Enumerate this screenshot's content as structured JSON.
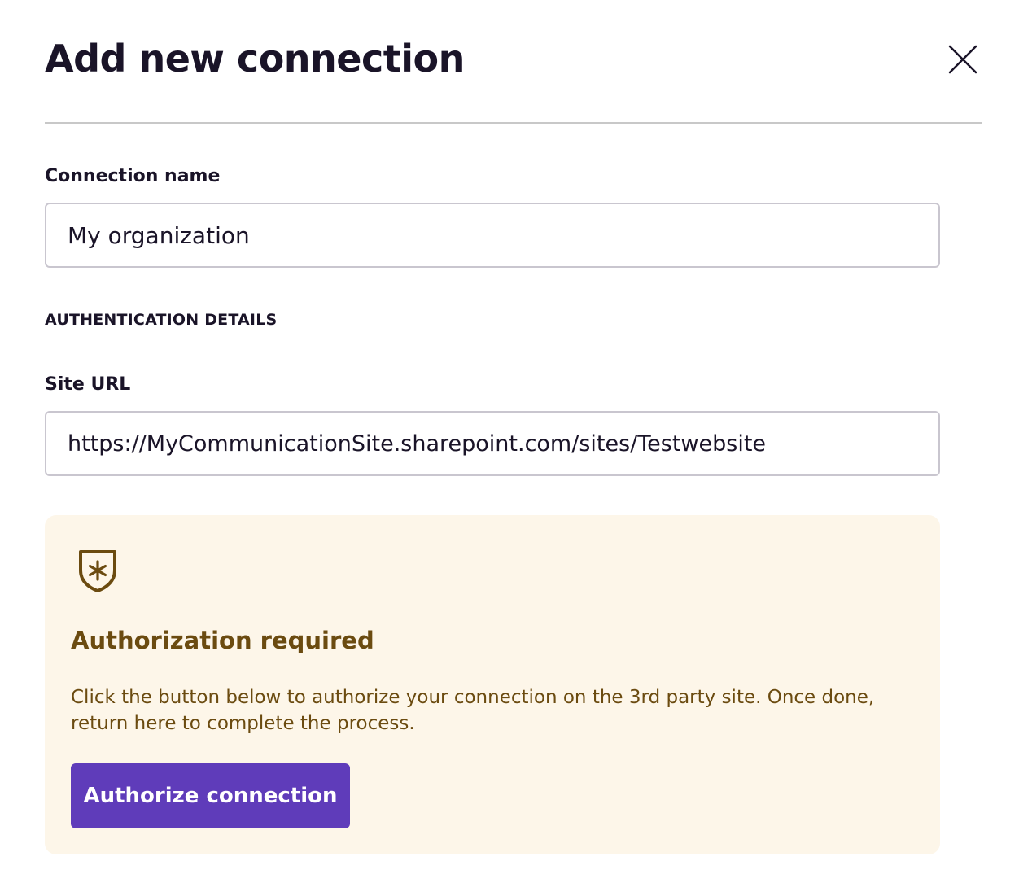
{
  "dialog": {
    "title": "Add new connection",
    "close_icon": "close-icon"
  },
  "form": {
    "connection_name_label": "Connection name",
    "connection_name_value": "My organization",
    "section_heading": "AUTHENTICATION DETAILS",
    "site_url_label": "Site URL",
    "site_url_value": "https://MyCommunicationSite.sharepoint.com/sites/Testwebsite"
  },
  "authorization": {
    "icon": "shield-asterisk-icon",
    "title": "Authorization required",
    "description": "Click the button below to authorize your connection on the 3rd party site. Once done, return here to complete the process.",
    "button_label": "Authorize connection"
  },
  "colors": {
    "text_primary": "#1a1428",
    "panel_background": "#fdf6e9",
    "panel_text": "#6b4b10",
    "button_background": "#5f3cba",
    "button_text": "#ffffff",
    "input_border": "#c9c6cf"
  }
}
